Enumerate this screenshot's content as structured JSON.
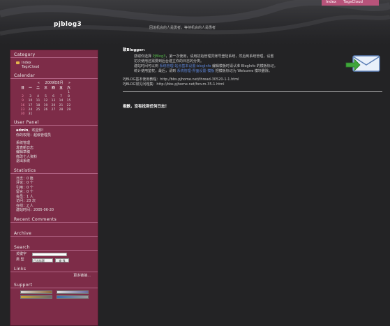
{
  "site": {
    "title": "pjblog3",
    "slogan": "回追机会的人是勇者，等待机会的人是愚者"
  },
  "topnav": [
    "Index",
    "TagsCloud"
  ],
  "sidebar": {
    "category": {
      "title": "Category",
      "items": [
        "Index",
        "TagsCloud"
      ]
    },
    "calendar": {
      "title": "Calendar",
      "month_label": "2009年8月",
      "prev": "«",
      "next": "»",
      "weekdays": [
        "日",
        "一",
        "二",
        "三",
        "四",
        "五",
        "六"
      ],
      "weeks": [
        [
          "",
          "",
          "",
          "",
          "",
          "",
          "1"
        ],
        [
          "2",
          "3",
          "4",
          "5",
          "6",
          "7",
          "8"
        ],
        [
          "9",
          "10",
          "11",
          "12",
          "13",
          "14",
          "15"
        ],
        [
          "16",
          "17",
          "18",
          "19",
          "20",
          "21",
          "22"
        ],
        [
          "23",
          "24",
          "25",
          "26",
          "27",
          "28",
          "29"
        ],
        [
          "30",
          "31",
          "",
          "",
          "",
          "",
          ""
        ]
      ]
    },
    "user_panel": {
      "title": "User Panel",
      "greeting_name": "admin",
      "greeting_suffix": "，欢迎你!",
      "role": "你的权限：超级管理员",
      "links": [
        "系统管理",
        "发表新日志",
        "编辑草稿",
        "修改个人资料",
        "退出系统"
      ]
    },
    "statistics": {
      "title": "Statistics",
      "lines": [
        "日志：0 篇",
        "评论：0 个",
        "引用：0 个",
        "留言：0 个",
        "会员：1 人",
        "访问：23 次",
        "在线：2 人",
        "建站时间：2005-06-20"
      ]
    },
    "recent_comments": {
      "title": "Recent Comments"
    },
    "archive": {
      "title": "Archive"
    },
    "search": {
      "title": "Search",
      "keyword_label": "关键字",
      "type_label": "类 型",
      "type_selected": "日志标题",
      "button": "查 找"
    },
    "links": {
      "title": "Links",
      "more": "更多链接..."
    },
    "support": {
      "title": "Support"
    }
  },
  "main": {
    "welcome_title": "致Blogger:",
    "para1_a": "感谢你选择 ",
    "para1_brand": "PJBlog3",
    "para1_b": "，第一次使用，请用初始管理员账号登陆系统，然后到系统管理，设置",
    "para2": "初次使用还需要到后台建立你的日志的分类。",
    "para3_a": "建站时间可以到 ",
    "para3_link": "系统管理-站点基本设置-blogInfo",
    "para3_b": " 编辑模板时请认准 BlogInfo 的模板标记。",
    "para4_a": "统计使用鉴权，最后，请到 ",
    "para4_link": "系统管理-界面设置-模板",
    "para4_b": " 把模板标记为 Welcome 模块删除。",
    "help1": "PJBLOG基本使用教程：http://bbs.pjhome.net/thread-30520-1-1.html",
    "help2": "PJBLOG常见问题集：http://bbs.pjhome.net/forum-35-1.html",
    "not_found": "抱歉，没有找到任何日志！"
  },
  "colors": {
    "sidebar_bg": "#7d2c48",
    "page_bg": "#232325",
    "nav_bg": "#b8537a"
  }
}
